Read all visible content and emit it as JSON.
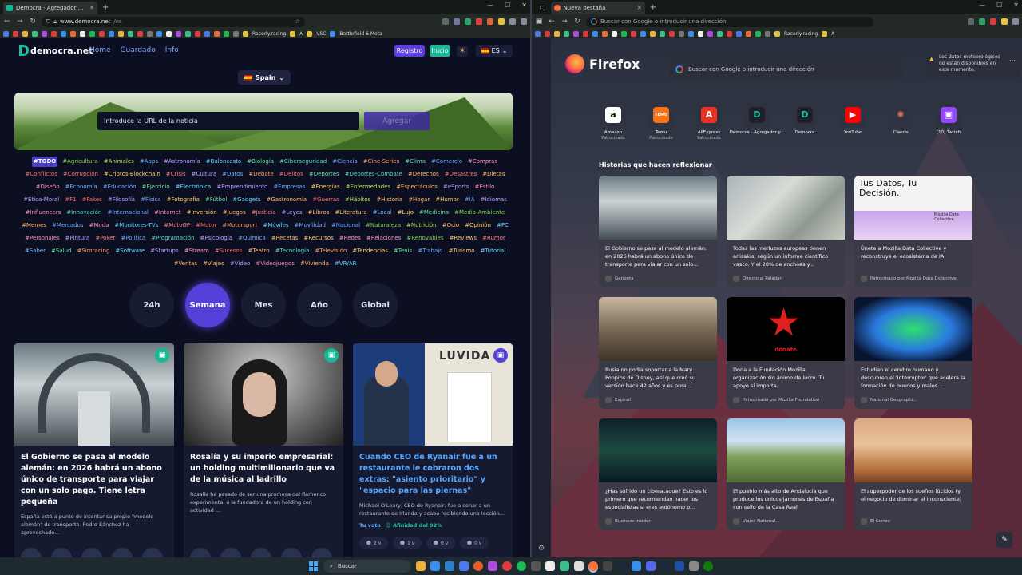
{
  "left_browser": {
    "tab_title": "Democra - Agregador y Evalua...",
    "url_host": "www.democra.net",
    "url_path": "/es",
    "bookmarks": [
      "Racerly.racing",
      "A",
      "VSC",
      "Battlefield 6 Meta"
    ],
    "site": {
      "logo": "democra.net",
      "nav": [
        "Home",
        "Guardado",
        "Info"
      ],
      "register_label": "Registro",
      "login_label": "Inicio",
      "lang_label": "ES",
      "country_label": "Spain",
      "url_placeholder": "Introduce la URL de la noticia",
      "add_label": "Agregar",
      "tags": [
        {
          "t": "#TODO",
          "c": "#ffffff",
          "active": true
        },
        {
          "t": "#Agricultura",
          "c": "#7fd34a"
        },
        {
          "t": "#Animales",
          "c": "#b8e35a"
        },
        {
          "t": "#Apps",
          "c": "#6fb6ff"
        },
        {
          "t": "#Astronomía",
          "c": "#c39bff"
        },
        {
          "t": "#Baloncesto",
          "c": "#6fd6ff"
        },
        {
          "t": "#Biología",
          "c": "#67e0a0"
        },
        {
          "t": "#Ciberseguridad",
          "c": "#5fdcc8"
        },
        {
          "t": "#Ciencia",
          "c": "#7aa8ff"
        },
        {
          "t": "#Cine-Series",
          "c": "#ff9f6b"
        },
        {
          "t": "#Clima",
          "c": "#64d6a4"
        },
        {
          "t": "#Comercio",
          "c": "#6fa7ff"
        },
        {
          "t": "#Compras",
          "c": "#ff8fc7"
        },
        {
          "t": "#Conflictos",
          "c": "#ff6b6b"
        },
        {
          "t": "#Corrupción",
          "c": "#ff6b6b"
        },
        {
          "t": "#Criptos-Blockchain",
          "c": "#ffd166"
        },
        {
          "t": "#Crisis",
          "c": "#ff7b7b"
        },
        {
          "t": "#Cultura",
          "c": "#c39bff"
        },
        {
          "t": "#Datos",
          "c": "#6fb6ff"
        },
        {
          "t": "#Debate",
          "c": "#ff9f6b"
        },
        {
          "t": "#Delitos",
          "c": "#ff6b6b"
        },
        {
          "t": "#Deportes",
          "c": "#6fe0a0"
        },
        {
          "t": "#Deportes-Combate",
          "c": "#5fd6b0"
        },
        {
          "t": "#Derechos",
          "c": "#ffb86b"
        },
        {
          "t": "#Desastres",
          "c": "#ff7b7b"
        },
        {
          "t": "#Dietas",
          "c": "#ffc36b"
        },
        {
          "t": "#Diseño",
          "c": "#ff8fc7"
        },
        {
          "t": "#Economía",
          "c": "#6fb6ff"
        },
        {
          "t": "#Educación",
          "c": "#7aa8ff"
        },
        {
          "t": "#Ejercicio",
          "c": "#6fe0a0"
        },
        {
          "t": "#Electrónica",
          "c": "#6fd6ff"
        },
        {
          "t": "#Emprendimiento",
          "c": "#c39bff"
        },
        {
          "t": "#Empresas",
          "c": "#6fa7ff"
        },
        {
          "t": "#Energías",
          "c": "#ffd166"
        },
        {
          "t": "#Enfermedades",
          "c": "#b8e35a"
        },
        {
          "t": "#Espectáculos",
          "c": "#ffb86b"
        },
        {
          "t": "#eSports",
          "c": "#c39bff"
        },
        {
          "t": "#Estilo",
          "c": "#ff8fc7"
        },
        {
          "t": "#Ética-Moral",
          "c": "#c39bff"
        },
        {
          "t": "#F1",
          "c": "#ff6b6b"
        },
        {
          "t": "#Fakes",
          "c": "#ff6b6b"
        },
        {
          "t": "#Filosofía",
          "c": "#c39bff"
        },
        {
          "t": "#Física",
          "c": "#7aa8ff"
        },
        {
          "t": "#Fotografía",
          "c": "#ffd166"
        },
        {
          "t": "#Fútbol",
          "c": "#6fe0a0"
        },
        {
          "t": "#Gadgets",
          "c": "#6fd6ff"
        },
        {
          "t": "#Gastronomía",
          "c": "#ffb86b"
        },
        {
          "t": "#Guerras",
          "c": "#ff6b6b"
        },
        {
          "t": "#Hábitos",
          "c": "#b8e35a"
        },
        {
          "t": "#Historia",
          "c": "#ffc36b"
        },
        {
          "t": "#Hogar",
          "c": "#ffb86b"
        },
        {
          "t": "#Humor",
          "c": "#ffd166"
        },
        {
          "t": "#IA",
          "c": "#6fb6ff"
        },
        {
          "t": "#Idiomas",
          "c": "#c39bff"
        },
        {
          "t": "#Influencers",
          "c": "#ff8fc7"
        },
        {
          "t": "#Innovación",
          "c": "#5fdcc8"
        },
        {
          "t": "#Internacional",
          "c": "#6fa7ff"
        },
        {
          "t": "#Internet",
          "c": "#ff8fc7"
        },
        {
          "t": "#Inversión",
          "c": "#ffd166"
        },
        {
          "t": "#Juegos",
          "c": "#ffb86b"
        },
        {
          "t": "#Justicia",
          "c": "#ff7b7b"
        },
        {
          "t": "#Leyes",
          "c": "#c39bff"
        },
        {
          "t": "#Libros",
          "c": "#ffb86b"
        },
        {
          "t": "#Literatura",
          "c": "#ffc36b"
        },
        {
          "t": "#Local",
          "c": "#6fb6ff"
        },
        {
          "t": "#Lujo",
          "c": "#ffd166"
        },
        {
          "t": "#Medicina",
          "c": "#6fe0a0"
        },
        {
          "t": "#Medio-Ambiente",
          "c": "#7fd34a"
        },
        {
          "t": "#Memes",
          "c": "#ffb86b"
        },
        {
          "t": "#Mercados",
          "c": "#6fa7ff"
        },
        {
          "t": "#Moda",
          "c": "#ff8fc7"
        },
        {
          "t": "#Monitores-TVs",
          "c": "#6fd6ff"
        },
        {
          "t": "#MotoGP",
          "c": "#ff7b7b"
        },
        {
          "t": "#Motor",
          "c": "#ff6b6b"
        },
        {
          "t": "#Motorsport",
          "c": "#ff9f6b"
        },
        {
          "t": "#Móviles",
          "c": "#6fd6ff"
        },
        {
          "t": "#Movilidad",
          "c": "#7aa8ff"
        },
        {
          "t": "#Nacional",
          "c": "#6fa7ff"
        },
        {
          "t": "#Naturaleza",
          "c": "#7fd34a"
        },
        {
          "t": "#Nutrición",
          "c": "#b8e35a"
        },
        {
          "t": "#Ocio",
          "c": "#ffb86b"
        },
        {
          "t": "#Opinión",
          "c": "#ffd166"
        },
        {
          "t": "#PC",
          "c": "#6fd6ff"
        },
        {
          "t": "#Personajes",
          "c": "#ff8fc7"
        },
        {
          "t": "#Pintura",
          "c": "#c39bff"
        },
        {
          "t": "#Poker",
          "c": "#ff7b7b"
        },
        {
          "t": "#Política",
          "c": "#6fa7ff"
        },
        {
          "t": "#Programación",
          "c": "#5fdcc8"
        },
        {
          "t": "#Psicología",
          "c": "#c39bff"
        },
        {
          "t": "#Química",
          "c": "#7aa8ff"
        },
        {
          "t": "#Recetas",
          "c": "#ffb86b"
        },
        {
          "t": "#Recursos",
          "c": "#ffd166"
        },
        {
          "t": "#Redes",
          "c": "#ff8fc7"
        },
        {
          "t": "#Relaciones",
          "c": "#ff8fc7"
        },
        {
          "t": "#Renovables",
          "c": "#7fd34a"
        },
        {
          "t": "#Reviews",
          "c": "#ffc36b"
        },
        {
          "t": "#Rumor",
          "c": "#ff7b7b"
        },
        {
          "t": "#Saber",
          "c": "#6fb6ff"
        },
        {
          "t": "#Salud",
          "c": "#6fe0a0"
        },
        {
          "t": "#Simracing",
          "c": "#ff9f6b"
        },
        {
          "t": "#Software",
          "c": "#6fd6ff"
        },
        {
          "t": "#Startups",
          "c": "#c39bff"
        },
        {
          "t": "#Stream",
          "c": "#ff8fc7"
        },
        {
          "t": "#Sucesos",
          "c": "#ff6b6b"
        },
        {
          "t": "#Teatro",
          "c": "#ffb86b"
        },
        {
          "t": "#Tecnología",
          "c": "#5fdcc8"
        },
        {
          "t": "#Televisión",
          "c": "#ff9f6b"
        },
        {
          "t": "#Tendencias",
          "c": "#ffd166"
        },
        {
          "t": "#Tenis",
          "c": "#6fe0a0"
        },
        {
          "t": "#Trabajo",
          "c": "#6fa7ff"
        },
        {
          "t": "#Turismo",
          "c": "#ffc36b"
        },
        {
          "t": "#Tutorial",
          "c": "#6fd6ff"
        },
        {
          "t": "#Ventas",
          "c": "#ffb86b"
        },
        {
          "t": "#Viajes",
          "c": "#ffc36b"
        },
        {
          "t": "#Vídeo",
          "c": "#c39bff"
        },
        {
          "t": "#Videojuegos",
          "c": "#ff8fc7"
        },
        {
          "t": "#Vivienda",
          "c": "#ffb86b"
        },
        {
          "t": "#VR/AR",
          "c": "#6fd6ff"
        }
      ],
      "periods": [
        "24h",
        "Semana",
        "Mes",
        "Año",
        "Global"
      ],
      "active_period": "Semana",
      "cards": [
        {
          "title": "El Gobierno se pasa al modelo alemán: en 2026 habrá un abono único de transporte para viajar con un solo pago. Tiene letra pequeña",
          "excerpt": "España está a punto de intentar su propio \"modelo alemán\" de transporte. Pedro Sánchez ha aprovechado...",
          "title_color": "#ffffff",
          "bookmark_color": "#19b894"
        },
        {
          "title": "Rosalía y su imperio empresarial: un holding multimillonario que va de la música al ladrillo",
          "excerpt": "Rosalía ha pasado de ser una promesa del flamenco experimental a la fundadora de un holding con actividad ...",
          "title_color": "#ffffff",
          "bookmark_color": "#19b894"
        },
        {
          "title": "Cuando CEO de Ryanair fue a un restaurante le cobraron dos extras: \"asiento prioritario\" y \"espacio para las piernas\"",
          "excerpt": "Michael O'Leary, CEO de Ryanair, fue a cenar a un restaurante de Irlanda y acabó recibiendo una lección...",
          "title_color": "#59a6ff",
          "bookmark_color": "#5340d8",
          "vote_label": "Tu voto",
          "affinity": "Afinidad del 92%",
          "chips": [
            "2 v",
            "1 v",
            "0 v",
            "0 v"
          ],
          "sign_text": "LUVIDA"
        }
      ]
    }
  },
  "right_browser": {
    "tab_title": "Nueva pestaña",
    "url_placeholder": "Buscar con Google o introducir una dirección",
    "bookmarks": [
      "Racerly.racing",
      "A"
    ],
    "brand": "Firefox",
    "search_placeholder": "Buscar con Google o introducir una dirección",
    "weather_msg": "Los datos meteorológicos no están disponibles en este momento.",
    "top_sites": [
      {
        "label": "Amazon",
        "sub": "Patrocinado",
        "color": "#ffffff",
        "glyph": "a",
        "glyph_color": "#111"
      },
      {
        "label": "Temu",
        "sub": "Patrocinado",
        "color": "#f97316",
        "glyph": "TEMU",
        "glyph_color": "#fff"
      },
      {
        "label": "AliExpress",
        "sub": "Patrocinado",
        "color": "#e43225",
        "glyph": "A",
        "glyph_color": "#fff"
      },
      {
        "label": "Democra - Agregador y...",
        "sub": "",
        "color": "#1e1f2a",
        "glyph": "D",
        "glyph_color": "#19c3a0"
      },
      {
        "label": "Democra",
        "sub": "",
        "color": "#1e1f2a",
        "glyph": "D",
        "glyph_color": "#19c3a0"
      },
      {
        "label": "YouTube",
        "sub": "",
        "color": "#ff0000",
        "glyph": "▶",
        "glyph_color": "#fff"
      },
      {
        "label": "Claude",
        "sub": "",
        "color": "#2f3240",
        "glyph": "✺",
        "glyph_color": "#d97757"
      },
      {
        "label": "(10) Twitch",
        "sub": "",
        "color": "#9146ff",
        "glyph": "▣",
        "glyph_color": "#fff"
      }
    ],
    "section_title": "Historias que hacen reflexionar",
    "stories": [
      {
        "title": "El Gobierno se pasa al modelo alemán: en 2026 habrá un abono único de transporte para viajar con un solo...",
        "source": "Genbeta"
      },
      {
        "title": "Todas las merluzas europeas tienen anisakis, según un informe científico vasco. Y el 20% de anchoas y...",
        "source": "Directo al Paladar"
      },
      {
        "title": "Únete a Mozilla Data Collective y reconstruye el ecosistema de IA",
        "source": "Patrocinado por Mozilla Data Collective",
        "img_heading": "Tus Datos, Tu Decisión.",
        "img_badge": "Mozilla Data Collective"
      },
      {
        "title": "Rusia no podía soportar a la Mary Poppins de Disney, así que creó su versión hace 42 años y es pura...",
        "source": "Espinof"
      },
      {
        "title": "Dona a la Fundación Mozilla, organización sin ánimo de lucro. Tu apoyo sí importa.",
        "source": "Patrocinado por Mozilla Foundation",
        "img_caption": "dónate"
      },
      {
        "title": "Estudian el cerebro humano y descubren el 'interruptor' que acelera la formación de buenos y malos...",
        "source": "National Geographi..."
      },
      {
        "title": "¿Has sufrido un ciberataque? Esto es lo primero que recomiendan hacer los especialistas si eres autónomo o...",
        "source": "Business Insider"
      },
      {
        "title": "El pueblo más alto de Andalucía que produce los únicos jamones de España con sello de la Casa Real",
        "source": "Viajes National..."
      },
      {
        "title": "El superpoder de los sueños lúcidos (y el negocio de dominar el inconsciente)",
        "source": "El Correo"
      }
    ]
  },
  "taskbar": {
    "search_label": "Buscar"
  }
}
